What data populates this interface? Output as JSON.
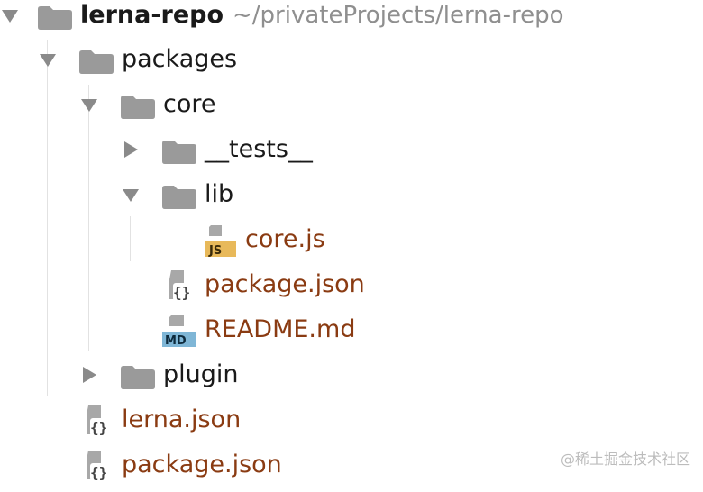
{
  "tree": {
    "root": {
      "name": "lerna-repo",
      "path": "~/privateProjects/lerna-repo"
    },
    "packages": "packages",
    "core": "core",
    "tests": "__tests__",
    "lib": "lib",
    "core_js": "core.js",
    "core_package_json": "package.json",
    "readme": "README.md",
    "plugin": "plugin",
    "lerna_json": "lerna.json",
    "root_package_json": "package.json"
  },
  "badges": {
    "js": "JS",
    "md": "MD"
  },
  "watermark": "@稀土掘金技术社区",
  "colors": {
    "folder": "#9a9a9a",
    "file_label": "#8a3b12",
    "js_badge": "#e8b95a",
    "md_badge": "#7fb6d6"
  }
}
